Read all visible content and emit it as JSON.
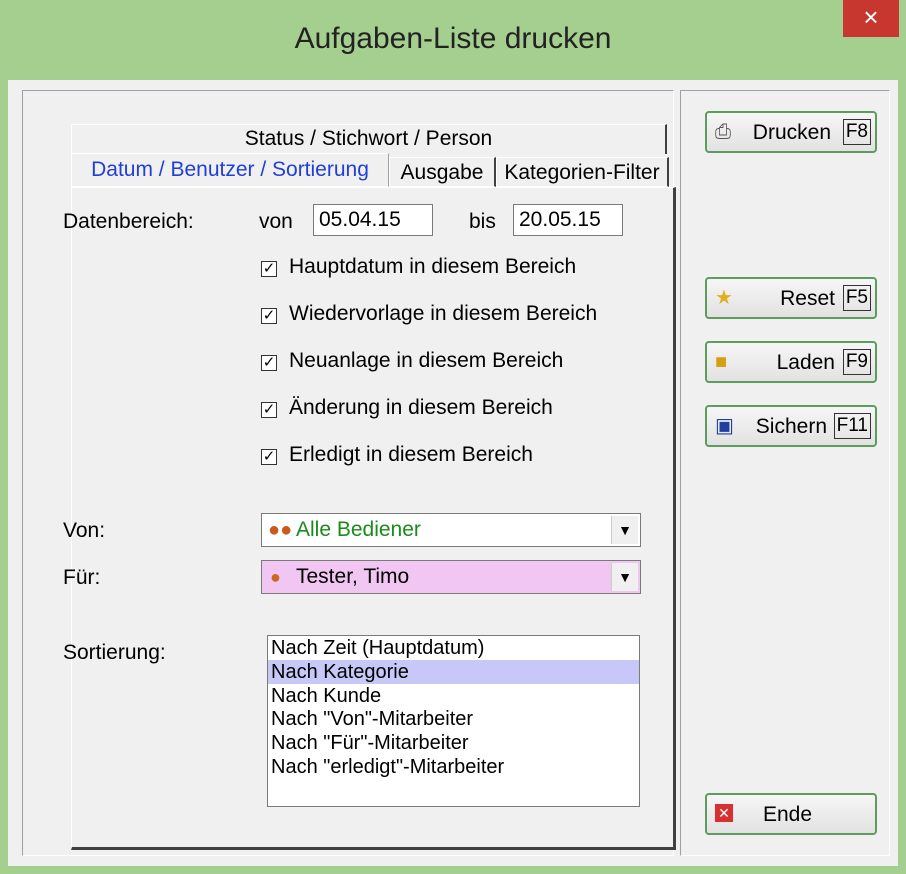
{
  "window": {
    "title": "Aufgaben-Liste drucken",
    "close_glyph": "×"
  },
  "tabs": {
    "status": "Status / Stichwort / Person",
    "datum": "Datum / Benutzer / Sortierung",
    "ausgabe": "Ausgabe",
    "kategorie": "Kategorien-Filter"
  },
  "date_range": {
    "label": "Datenbereich:",
    "from_label": "von",
    "from_value": "05.04.15",
    "to_label": "bis",
    "to_value": "20.05.15"
  },
  "checkboxes": [
    {
      "label": "Hauptdatum in diesem Bereich",
      "checked": true
    },
    {
      "label": "Wiedervorlage in diesem Bereich",
      "checked": true
    },
    {
      "label": "Neuanlage in diesem Bereich",
      "checked": true
    },
    {
      "label": "Änderung in diesem Bereich",
      "checked": true
    },
    {
      "label": "Erledigt in diesem Bereich",
      "checked": true
    }
  ],
  "check_glyph": "✓",
  "von": {
    "label": "Von:",
    "value": "Alle Bediener",
    "icon": "users-icon",
    "color": "#1a8a1a"
  },
  "fuer": {
    "label": "Für:",
    "value": "Tester, Timo",
    "icon": "user-icon",
    "bg": "#f2c6f2"
  },
  "sortierung": {
    "label": "Sortierung:",
    "items": [
      "Nach Zeit (Hauptdatum)",
      "Nach Kategorie",
      "Nach Kunde",
      "Nach \"Von\"-Mitarbeiter",
      "Nach \"Für\"-Mitarbeiter",
      "Nach \"erledigt\"-Mitarbeiter"
    ],
    "selected": "Nach Kategorie"
  },
  "buttons": {
    "drucken": {
      "label": "Drucken",
      "key": "F8",
      "icon": "printer-icon"
    },
    "reset": {
      "label": "Reset",
      "key": "F5",
      "icon": "star-icon"
    },
    "laden": {
      "label": "Laden",
      "key": "F9",
      "icon": "folder-open-icon"
    },
    "sichern": {
      "label": "Sichern",
      "key": "F11",
      "icon": "floppy-disk-icon"
    },
    "ende": {
      "label": "Ende",
      "icon": "close-icon"
    }
  }
}
